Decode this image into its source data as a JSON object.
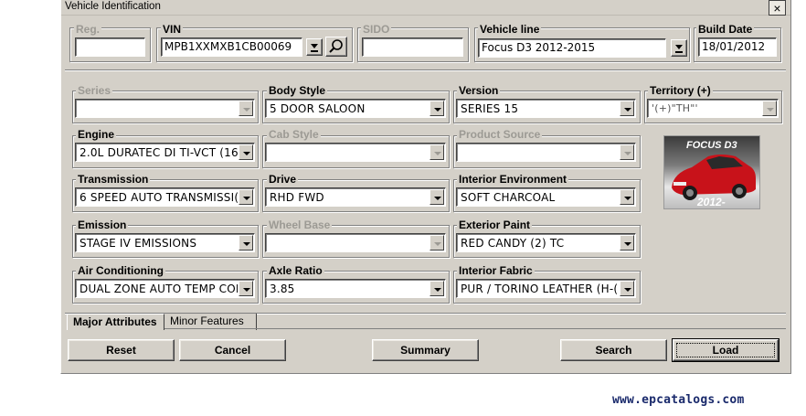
{
  "window": {
    "title": "Vehicle Identification",
    "close_glyph": "×"
  },
  "top": {
    "reg": {
      "label": "Reg.",
      "value": ""
    },
    "vin": {
      "label": "VIN",
      "value": "MPB1XXMXB1CB00069"
    },
    "sido": {
      "label": "SIDO",
      "value": ""
    },
    "vehicle_line": {
      "label": "Vehicle line",
      "value": "Focus D3 2012-2015"
    },
    "build_date": {
      "label": "Build Date",
      "value": "18/01/2012"
    }
  },
  "fields": {
    "series": {
      "label": "Series",
      "value": "",
      "enabled": false
    },
    "body_style": {
      "label": "Body Style",
      "value": "5 DOOR SALOON",
      "enabled": true
    },
    "version": {
      "label": "Version",
      "value": "SERIES 15",
      "enabled": true
    },
    "territory": {
      "label": "Territory (+)",
      "value": "'(+)\"TH\"'",
      "enabled": false
    },
    "engine": {
      "label": "Engine",
      "value": "2.0L DURATEC DI TI-VCT (16(",
      "enabled": true
    },
    "cab_style": {
      "label": "Cab Style",
      "value": "",
      "enabled": false
    },
    "product_source": {
      "label": "Product Source",
      "value": "",
      "enabled": false
    },
    "transmission": {
      "label": "Transmission",
      "value": "6 SPEED AUTO TRANSMISSI(",
      "enabled": true
    },
    "drive": {
      "label": "Drive",
      "value": "RHD FWD",
      "enabled": true
    },
    "interior_environment": {
      "label": "Interior Environment",
      "value": "SOFT CHARCOAL",
      "enabled": true
    },
    "emission": {
      "label": "Emission",
      "value": "STAGE IV EMISSIONS",
      "enabled": true
    },
    "wheel_base": {
      "label": "Wheel Base",
      "value": "",
      "enabled": false
    },
    "exterior_paint": {
      "label": "Exterior Paint",
      "value": "RED CANDY (2) TC",
      "enabled": true
    },
    "air_conditioning": {
      "label": "Air Conditioning",
      "value": "DUAL ZONE AUTO TEMP CON",
      "enabled": true
    },
    "axle_ratio": {
      "label": "Axle Ratio",
      "value": "3.85",
      "enabled": true
    },
    "interior_fabric": {
      "label": "Interior Fabric",
      "value": "PUR / TORINO LEATHER (H-(",
      "enabled": true
    }
  },
  "car_image": {
    "title": "FOCUS D3",
    "year": "2012-"
  },
  "tabs": [
    {
      "label": "Major Attributes",
      "active": true
    },
    {
      "label": "Minor Features",
      "active": false
    }
  ],
  "buttons": {
    "reset": "Reset",
    "cancel": "Cancel",
    "summary": "Summary",
    "search": "Search",
    "load": "Load"
  },
  "watermark": "www.epcatalogs.com"
}
